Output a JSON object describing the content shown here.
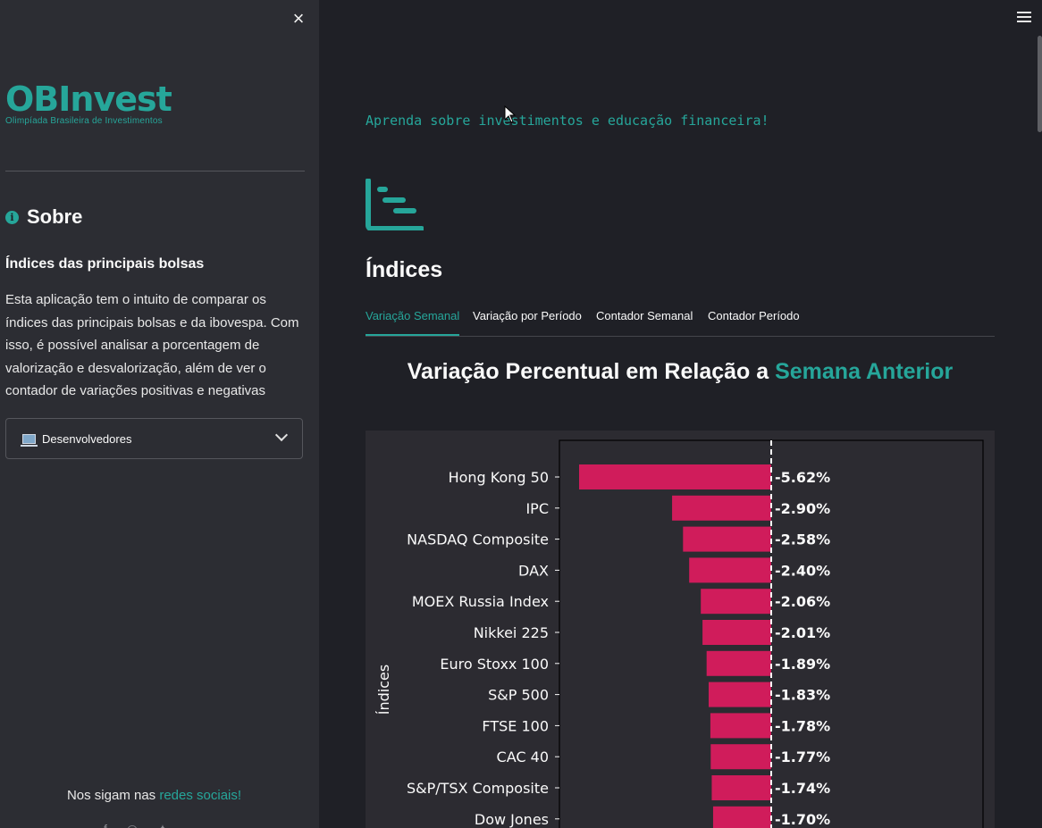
{
  "sidebar": {
    "close_glyph": "×",
    "logo_text": "OBInvest",
    "logo_subtitle": "Olimpíada Brasileira de Investimentos",
    "about_title": "Sobre",
    "subtitle": "Índices das principais bolsas",
    "description": "Esta aplicação tem o intuito de comparar os índices das principais bolsas e da ibovespa. Com isso, é possível analisar a porcentagem de valorização e desvalorização, além de ver o contador de variações positivas e negativas",
    "expander_label": "Desenvolvedores",
    "social_prefix": "Nos sigam nas ",
    "social_link": "redes sociais!"
  },
  "main": {
    "tagline": "Aprenda sobre investimentos e educação financeira!",
    "section_title": "Índices",
    "tabs": [
      {
        "label": "Variação Semanal",
        "active": true
      },
      {
        "label": "Variação por Período",
        "active": false
      },
      {
        "label": "Contador Semanal",
        "active": false
      },
      {
        "label": "Contador Período",
        "active": false
      }
    ],
    "chart_title_prefix": "Variação Percentual em Relação a ",
    "chart_title_accent": "Semana Anterior"
  },
  "colors": {
    "accent": "#26a69a",
    "bar": "#d01c5b",
    "background": "#1f2026",
    "sidebar": "#2c2d33"
  },
  "chart_data": {
    "type": "bar",
    "orientation": "horizontal",
    "ylabel": "Índices",
    "categories": [
      "Hong Kong 50",
      "IPC",
      "NASDAQ Composite",
      "DAX",
      "MOEX Russia Index",
      "Nikkei 225",
      "Euro Stoxx 100",
      "S&P 500",
      "FTSE 100",
      "CAC 40",
      "S&P/TSX Composite",
      "Dow Jones"
    ],
    "values": [
      -5.62,
      -2.9,
      -2.58,
      -2.4,
      -2.06,
      -2.01,
      -1.89,
      -1.83,
      -1.78,
      -1.77,
      -1.74,
      -1.7
    ],
    "labels": [
      "-5.62%",
      "-2.90%",
      "-2.58%",
      "-2.40%",
      "-2.06%",
      "-2.01%",
      "-1.89%",
      "-1.83%",
      "-1.78%",
      "-1.77%",
      "-1.74%",
      "-1.70%"
    ],
    "reference_line": 0
  }
}
